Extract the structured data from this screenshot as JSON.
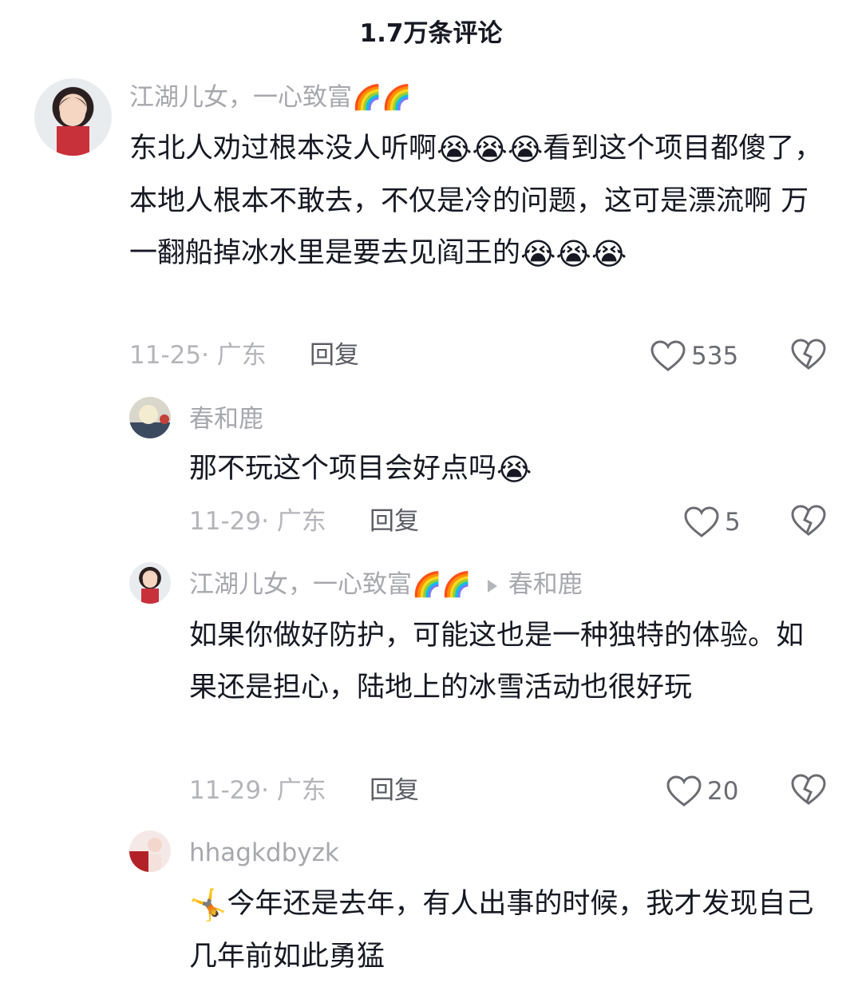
{
  "header": {
    "title": "1.7万条评论"
  },
  "comments": [
    {
      "username": "江湖儿女，一心致富",
      "username_emoji": "🌈🌈",
      "text_parts": [
        "东北人劝过根本没人听啊",
        "😭😭😭",
        "看到这个项目都傻了，本地人根本不敢去，不仅是冷的问题，这可是漂流啊  万一翻船掉冰水里是要去见阎王的",
        "😭😭😭"
      ],
      "date_location": "11-25· 广东",
      "reply_label": "回复",
      "likes": "535",
      "avatar_icon": "child-avatar"
    },
    {
      "username": "春和鹿",
      "text_parts": [
        "那不玩这个项目会好点吗",
        "😭"
      ],
      "date_location": "11-29· 广东",
      "reply_label": "回复",
      "likes": "5",
      "avatar_icon": "plush-avatar"
    },
    {
      "username": "江湖儿女，一心致富",
      "username_emoji": "🌈🌈",
      "reply_to": "春和鹿",
      "text_parts": [
        "如果你做好防护，可能这也是一种独特的体验。如果还是担心，陆地上的冰雪活动也很好玩"
      ],
      "date_location": "11-29· 广东",
      "reply_label": "回复",
      "likes": "20",
      "avatar_icon": "child-avatar"
    },
    {
      "username": "hhagkdbyzk",
      "text_parts": [
        "🤸",
        "今年还是去年，有人出事的时候，我才发现自己几年前如此勇猛"
      ],
      "avatar_icon": "woman-avatar"
    }
  ],
  "colors": {
    "text": "#161823",
    "muted": "#a7a8ad",
    "meta": "#b4b5ba"
  }
}
